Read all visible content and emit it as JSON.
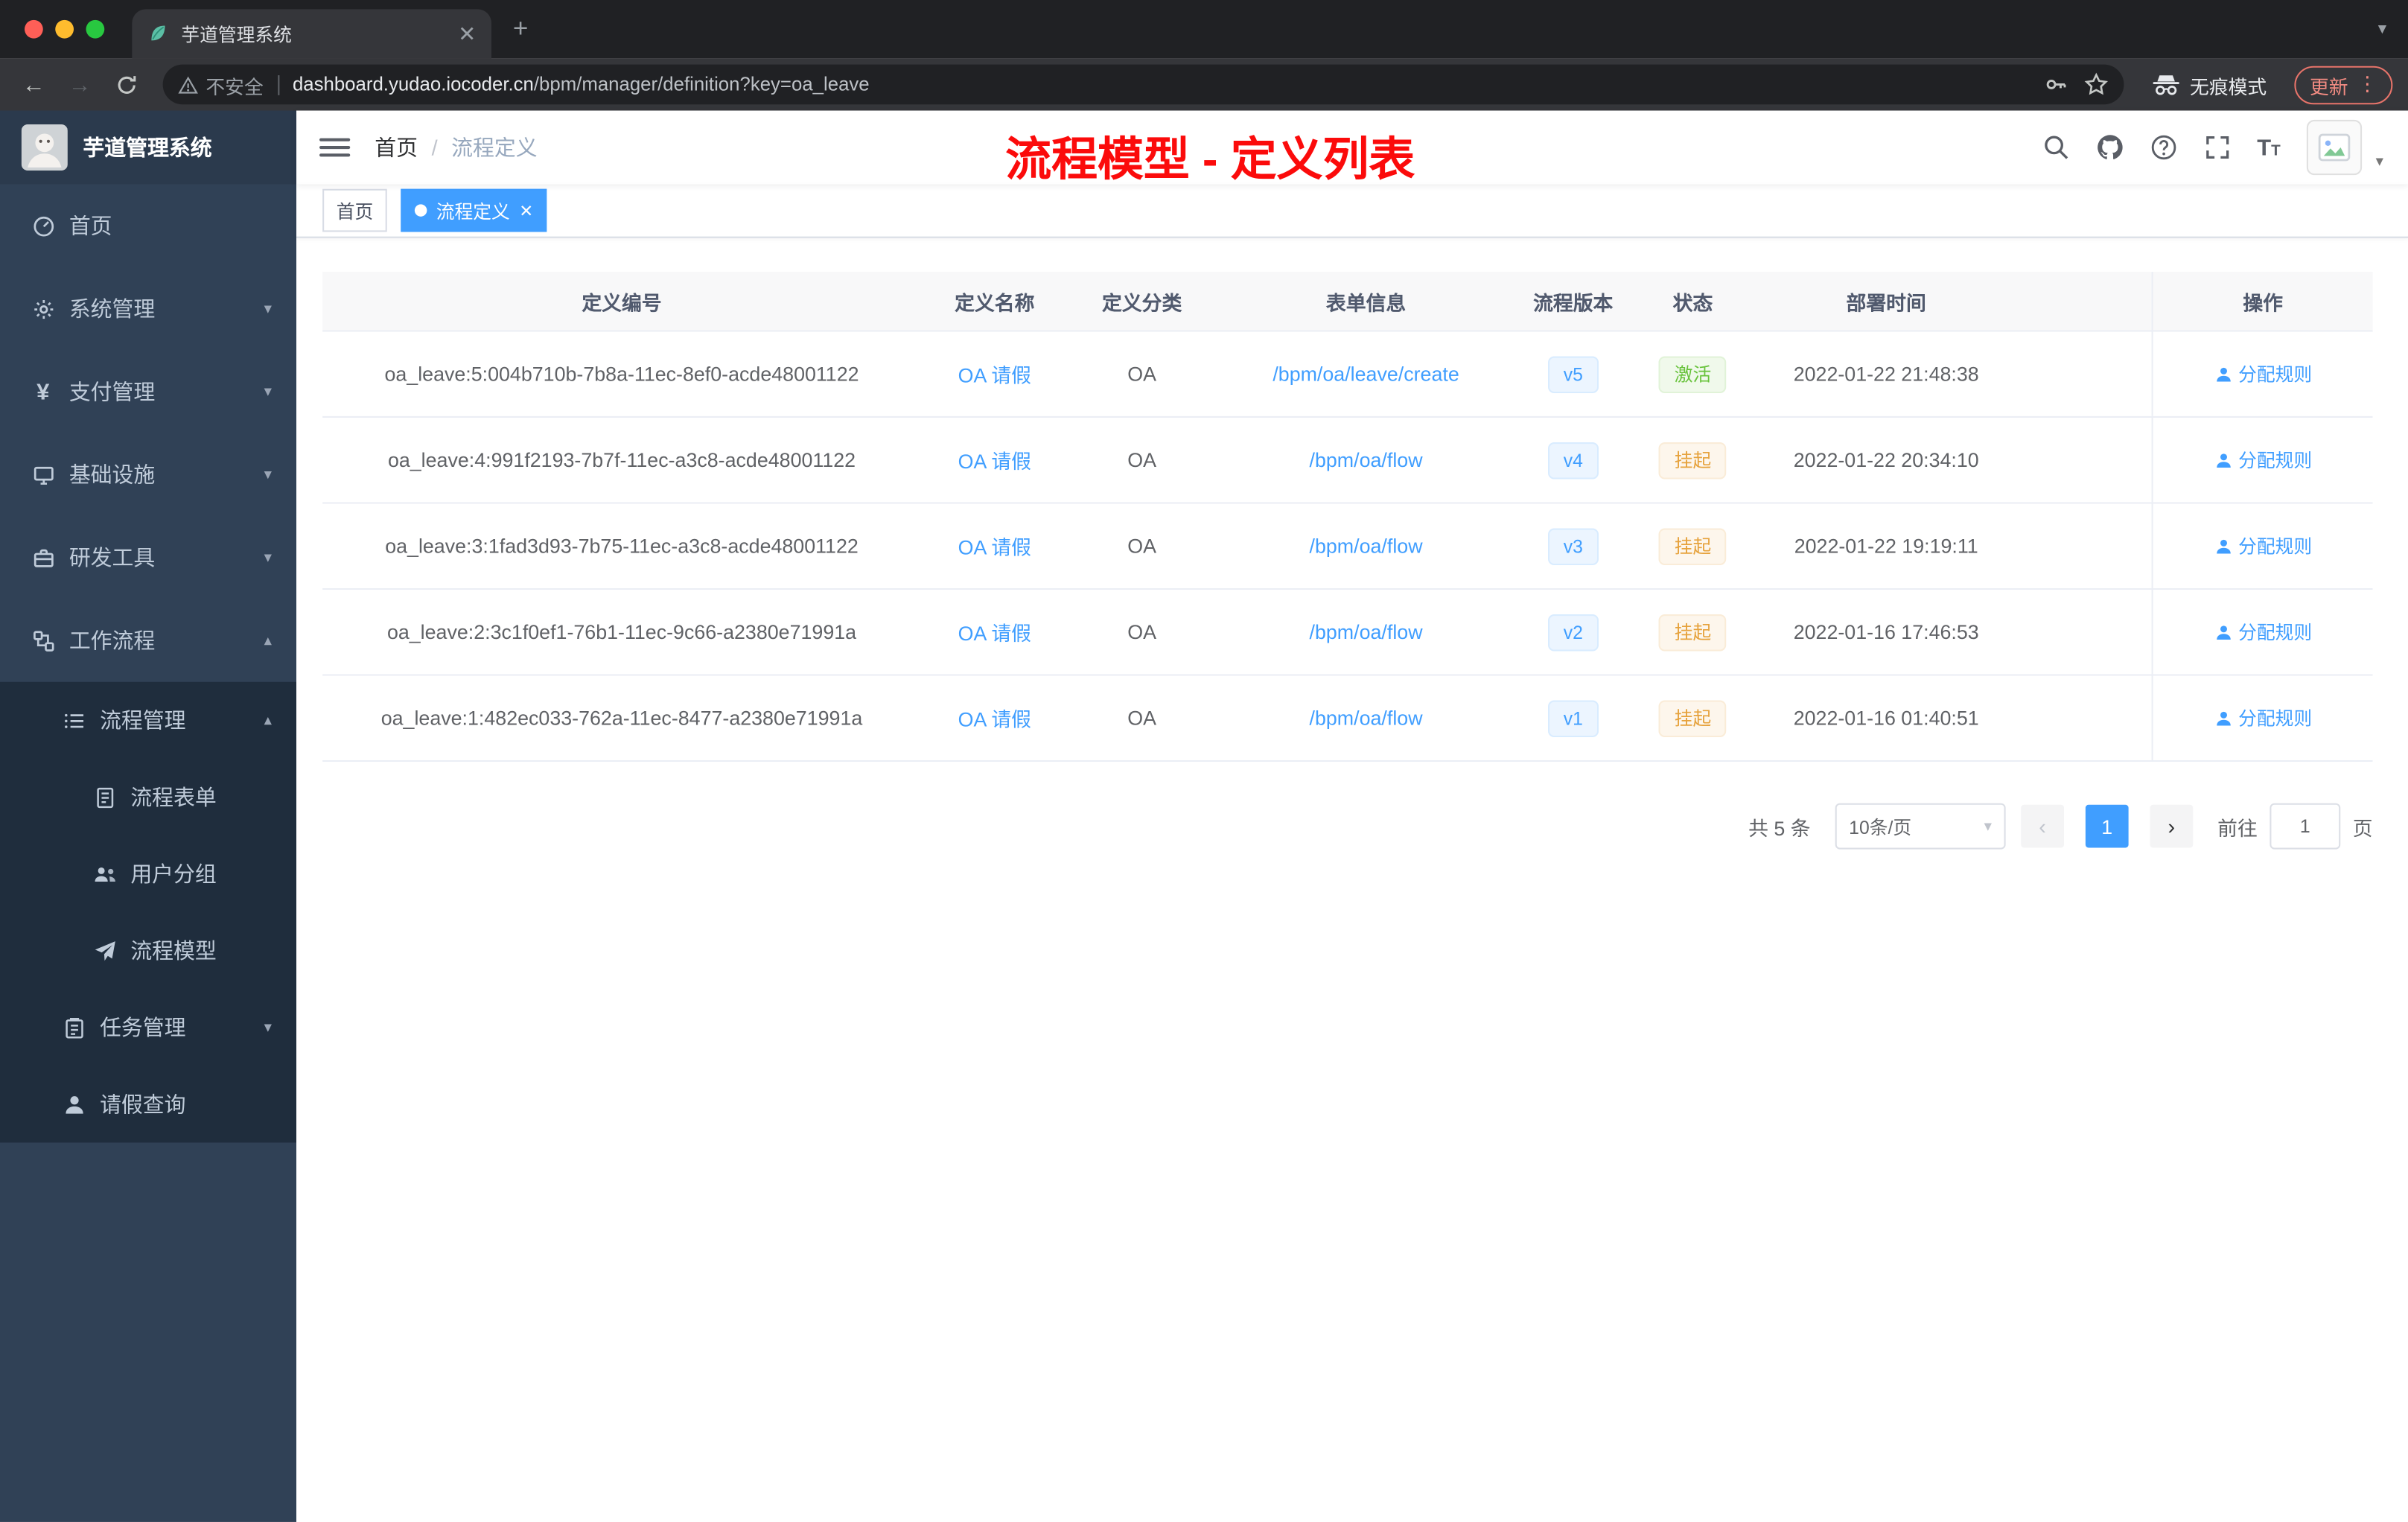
{
  "browser": {
    "tab_title": "芋道管理系统",
    "security_label": "不安全",
    "url_domain": "dashboard.yudao.iocoder.cn",
    "url_path": "/bpm/manager/definition?key=oa_leave",
    "incognito_label": "无痕模式",
    "update_button": "更新"
  },
  "sidebar": {
    "app_title": "芋道管理系统",
    "items": [
      {
        "label": "首页",
        "icon": "dashboard-icon",
        "level": 1
      },
      {
        "label": "系统管理",
        "icon": "gear-icon",
        "level": 1,
        "state": "collapsed"
      },
      {
        "label": "支付管理",
        "icon": "yen-icon",
        "level": 1,
        "state": "collapsed"
      },
      {
        "label": "基础设施",
        "icon": "monitor-icon",
        "level": 1,
        "state": "collapsed"
      },
      {
        "label": "研发工具",
        "icon": "toolbox-icon",
        "level": 1,
        "state": "collapsed"
      },
      {
        "label": "工作流程",
        "icon": "workflow-icon",
        "level": 1,
        "state": "expanded"
      },
      {
        "label": "流程管理",
        "icon": "list-icon",
        "level": 2,
        "state": "expanded"
      },
      {
        "label": "流程表单",
        "icon": "form-icon",
        "level": 3
      },
      {
        "label": "用户分组",
        "icon": "users-icon",
        "level": 3
      },
      {
        "label": "流程模型",
        "icon": "paper-plane-icon",
        "level": 3
      },
      {
        "label": "任务管理",
        "icon": "clipboard-icon",
        "level": 2,
        "state": "collapsed"
      },
      {
        "label": "请假查询",
        "icon": "user-icon",
        "level": 2
      }
    ]
  },
  "header": {
    "breadcrumb": {
      "home": "首页",
      "separator": "/",
      "current": "流程定义"
    },
    "annotation": "流程模型 - 定义列表"
  },
  "tags": {
    "items": [
      {
        "label": "首页",
        "active": false
      },
      {
        "label": "流程定义",
        "active": true
      }
    ]
  },
  "table": {
    "columns": [
      "定义编号",
      "定义名称",
      "定义分类",
      "表单信息",
      "流程版本",
      "状态",
      "部署时间",
      "操作"
    ],
    "rows": [
      {
        "id": "oa_leave:5:004b710b-7b8a-11ec-8ef0-acde48001122",
        "name": "OA 请假",
        "category": "OA",
        "form": "/bpm/oa/leave/create",
        "version": "v5",
        "status": "激活",
        "status_type": "success",
        "deploy_time": "2022-01-22 21:48:38",
        "action": "分配规则"
      },
      {
        "id": "oa_leave:4:991f2193-7b7f-11ec-a3c8-acde48001122",
        "name": "OA 请假",
        "category": "OA",
        "form": "/bpm/oa/flow",
        "version": "v4",
        "status": "挂起",
        "status_type": "warning",
        "deploy_time": "2022-01-22 20:34:10",
        "action": "分配规则"
      },
      {
        "id": "oa_leave:3:1fad3d93-7b75-11ec-a3c8-acde48001122",
        "name": "OA 请假",
        "category": "OA",
        "form": "/bpm/oa/flow",
        "version": "v3",
        "status": "挂起",
        "status_type": "warning",
        "deploy_time": "2022-01-22 19:19:11",
        "action": "分配规则"
      },
      {
        "id": "oa_leave:2:3c1f0ef1-76b1-11ec-9c66-a2380e71991a",
        "name": "OA 请假",
        "category": "OA",
        "form": "/bpm/oa/flow",
        "version": "v2",
        "status": "挂起",
        "status_type": "warning",
        "deploy_time": "2022-01-16 17:46:53",
        "action": "分配规则"
      },
      {
        "id": "oa_leave:1:482ec033-762a-11ec-8477-a2380e71991a",
        "name": "OA 请假",
        "category": "OA",
        "form": "/bpm/oa/flow",
        "version": "v1",
        "status": "挂起",
        "status_type": "warning",
        "deploy_time": "2022-01-16 01:40:51",
        "action": "分配规则"
      }
    ]
  },
  "pagination": {
    "total": "共 5 条",
    "page_size": "10条/页",
    "current_page": "1",
    "goto_label": "前往",
    "goto_value": "1",
    "unit_label": "页"
  },
  "colors": {
    "accent": "#409eff",
    "success": "#67c23a",
    "warning": "#e6a23c",
    "annotation_red": "#fb0b0b",
    "sidebar_bg": "#304156",
    "submenu_bg": "#1f2d3d"
  }
}
